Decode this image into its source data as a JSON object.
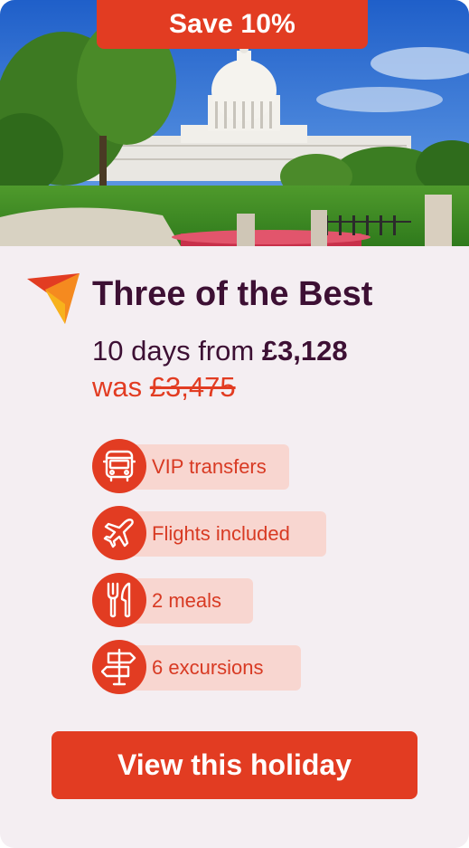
{
  "badge": {
    "label": "Save 10%"
  },
  "hero": {
    "image_subject": "capitol-building-photo"
  },
  "tour": {
    "title": "Three of the Best",
    "duration": "10 days from",
    "price": "£3,128",
    "was_label": "was",
    "was_price": "£3,475"
  },
  "features": [
    {
      "label": "VIP transfers",
      "icon": "coach-icon"
    },
    {
      "label": "Flights included",
      "icon": "plane-icon"
    },
    {
      "label": "2 meals",
      "icon": "cutlery-icon"
    },
    {
      "label": "6 excursions",
      "icon": "signpost-icon"
    }
  ],
  "cta": {
    "label": "View this holiday"
  },
  "colors": {
    "accent": "#e23c22",
    "title": "#3d1034",
    "card_bg": "#f4eef2",
    "pill_bg": "#f8d6d0"
  }
}
